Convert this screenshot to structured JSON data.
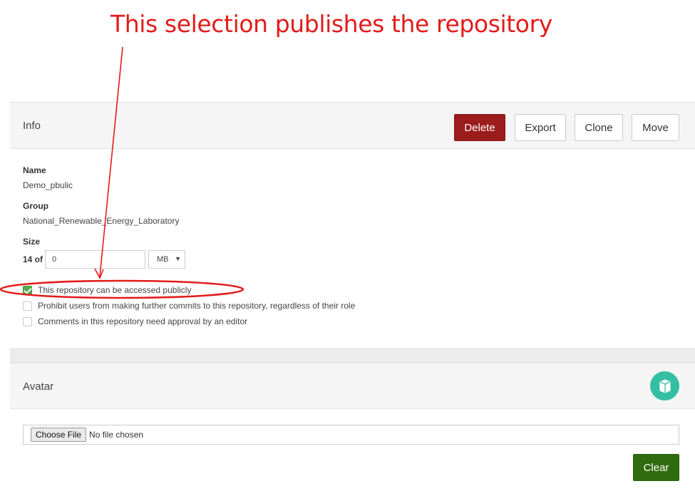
{
  "annotation": {
    "title": "This selection publishes the repository"
  },
  "info_panel": {
    "heading": "Info",
    "buttons": {
      "delete": "Delete",
      "export": "Export",
      "clone": "Clone",
      "move": "Move"
    },
    "name_label": "Name",
    "name_value": "Demo_pbulic",
    "group_label": "Group",
    "group_value": "National_Renewable_Energy_Laboratory",
    "size_label": "Size",
    "size_prefix": "14 of",
    "size_input_value": "0",
    "size_unit": "MB",
    "checkboxes": [
      {
        "label": "This repository can be accessed publicly",
        "checked": true
      },
      {
        "label": "Prohibit users from making further commits to this repository, regardless of their role",
        "checked": false
      },
      {
        "label": "Comments in this repository need approval by an editor",
        "checked": false
      }
    ]
  },
  "avatar_panel": {
    "heading": "Avatar",
    "choose_file_label": "Choose File",
    "no_file_text": "No file chosen",
    "clear_label": "Clear"
  },
  "colors": {
    "annotation_red": "#e31b1b",
    "delete_red": "#9b1c1c",
    "clear_green": "#2f6b10",
    "avatar_teal": "#34bfa3",
    "checkbox_green": "#4cae4c"
  },
  "icons": {
    "avatar": "cube-icon",
    "select_caret": "caret-down-icon",
    "checkmark": "checkmark-icon"
  }
}
